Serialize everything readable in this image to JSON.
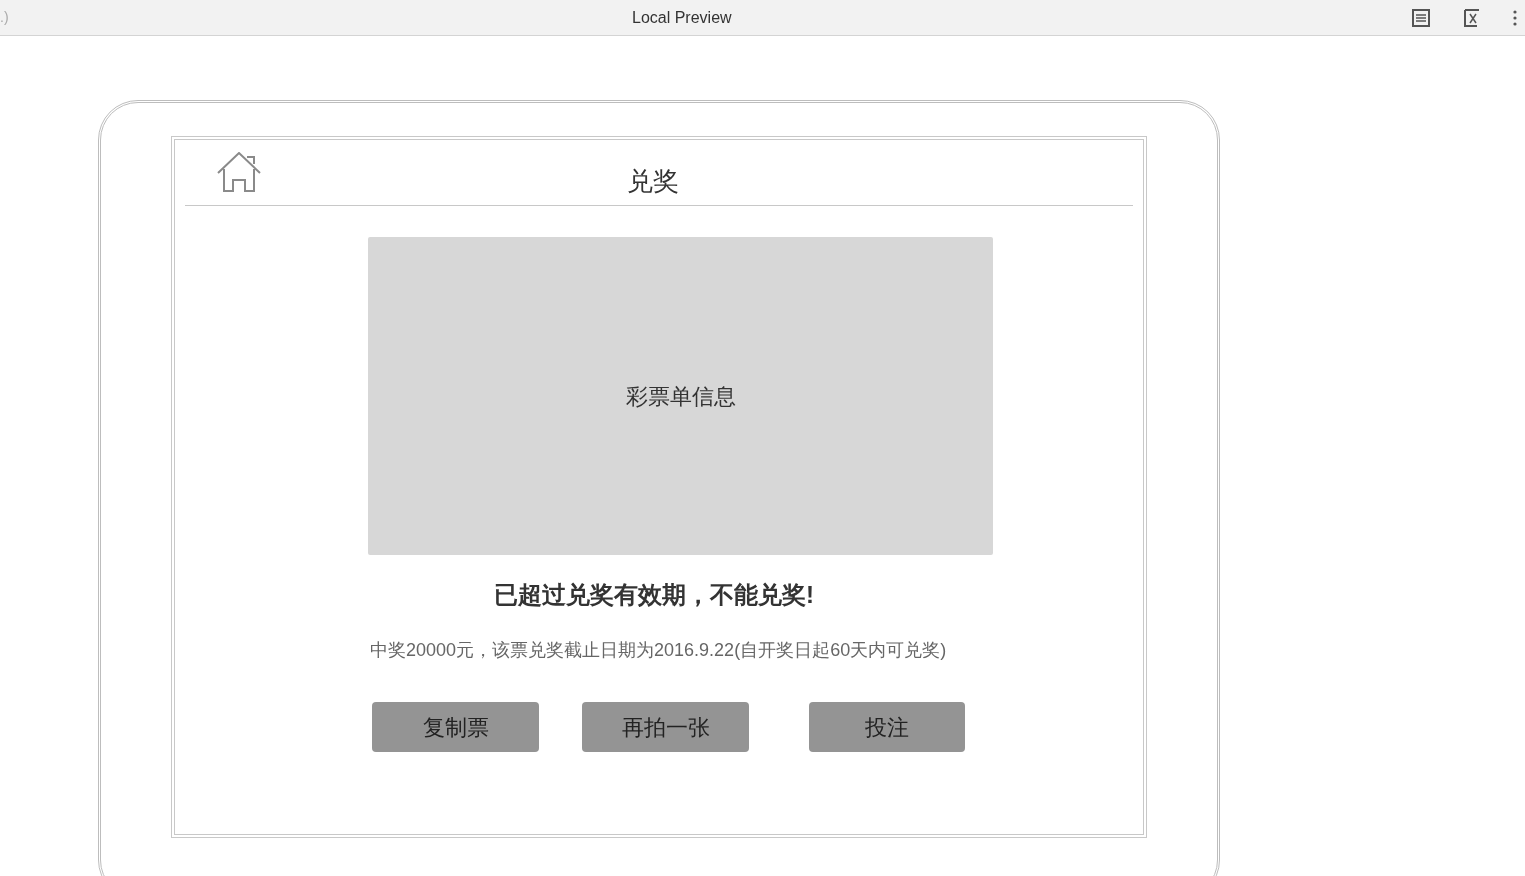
{
  "browser_bar": {
    "tab_fragment": ".)",
    "title": "Local Preview"
  },
  "screen": {
    "title": "兑奖",
    "ticket_placeholder": "彩票单信息",
    "message": "已超过兑奖有效期，不能兑奖!",
    "detail": "中奖20000元，该票兑奖截止日期为2016.9.22(自开奖日起60天内可兑奖)",
    "buttons": [
      "复制票",
      "再拍一张",
      "投注"
    ]
  }
}
